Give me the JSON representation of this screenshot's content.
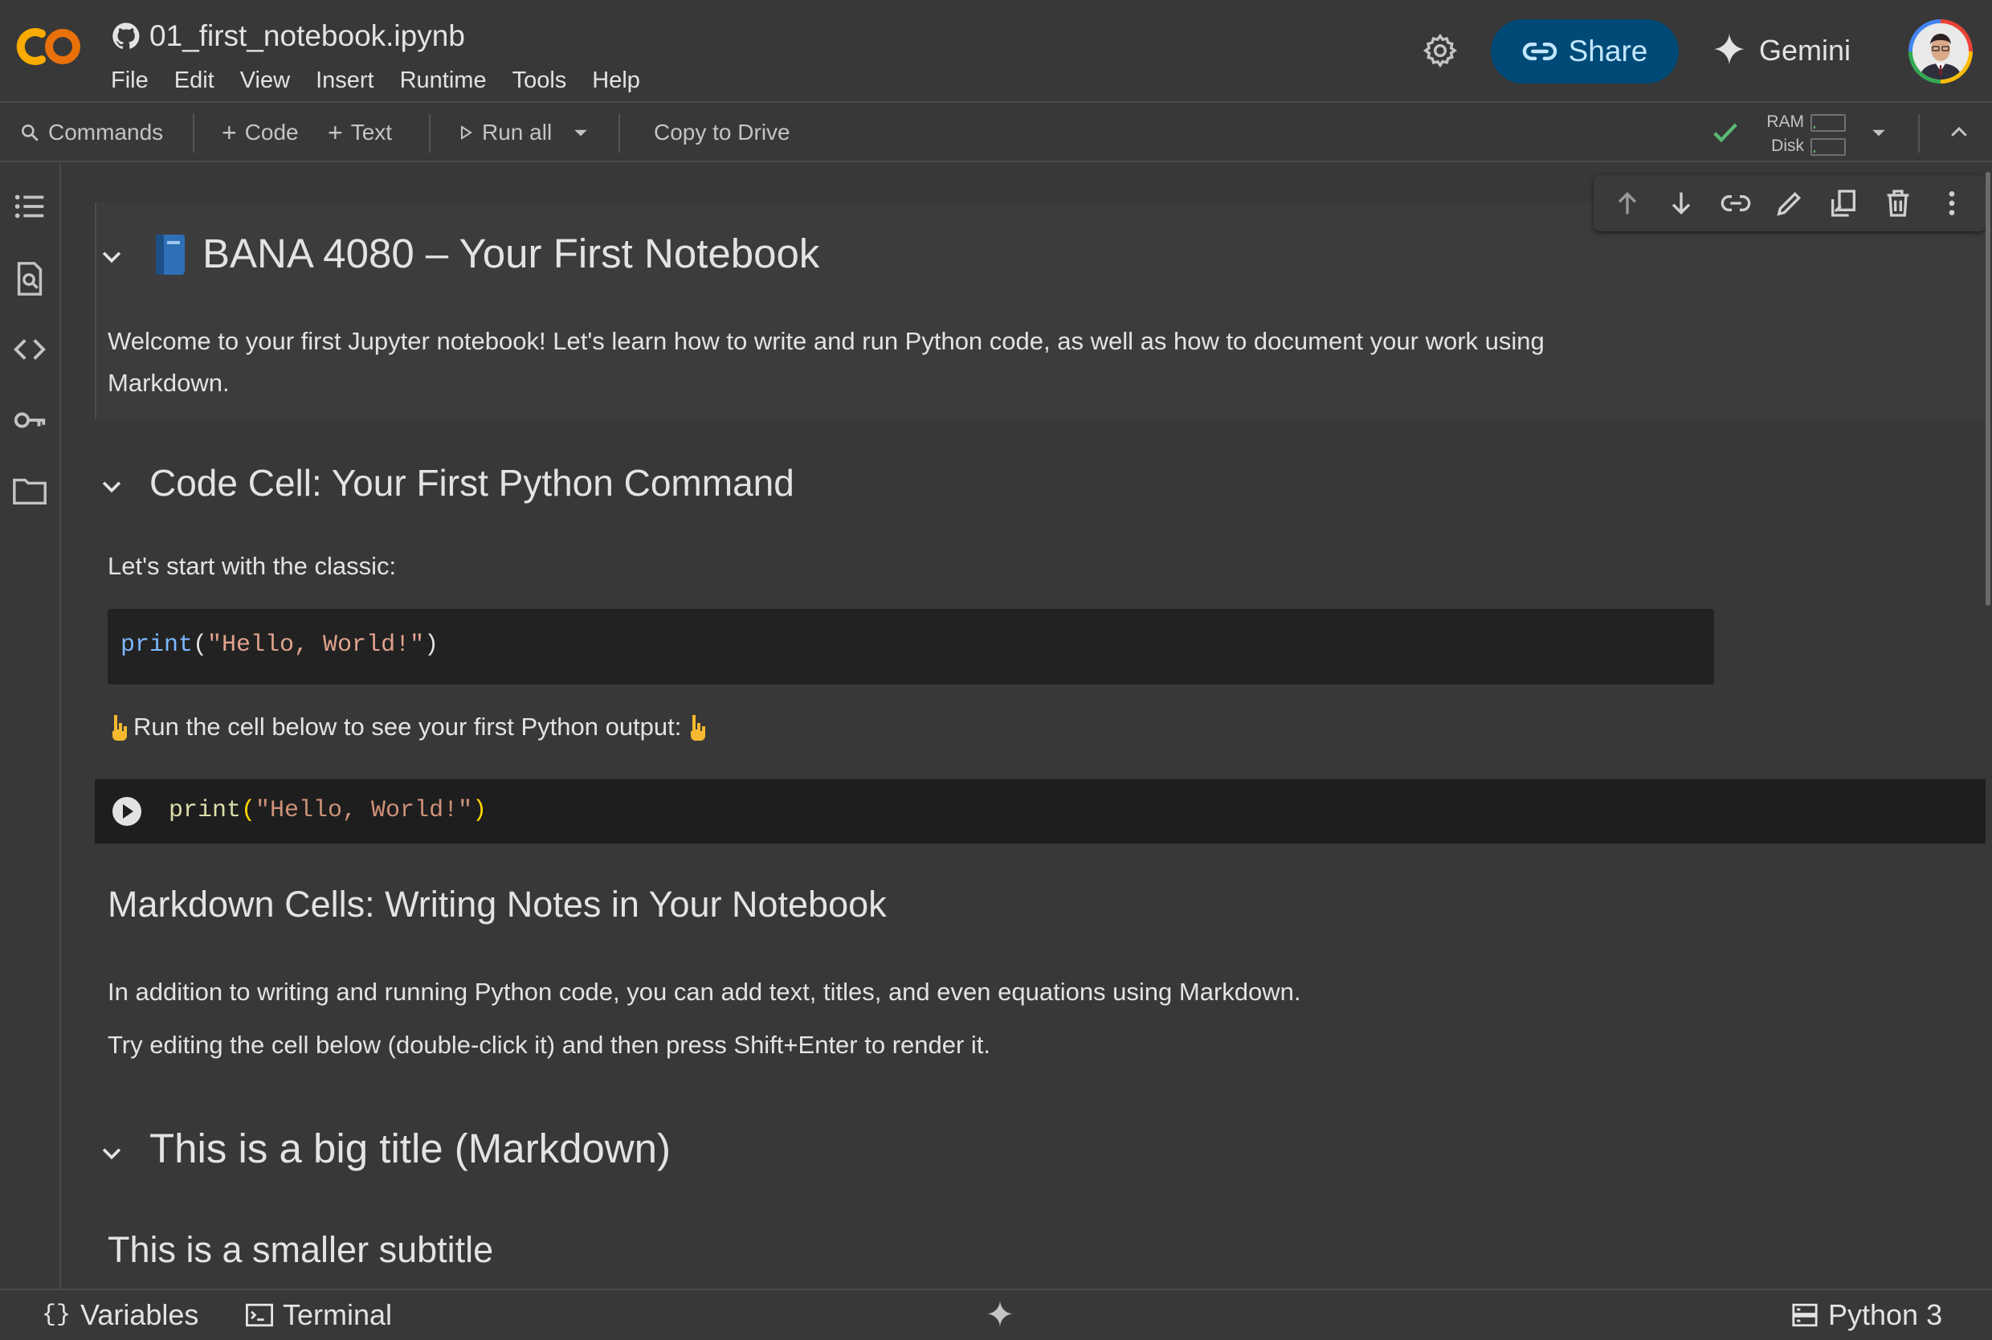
{
  "header": {
    "doc_title": "01_first_notebook.ipynb",
    "menu": [
      "File",
      "Edit",
      "View",
      "Insert",
      "Runtime",
      "Tools",
      "Help"
    ],
    "share_label": "Share",
    "gemini_label": "Gemini"
  },
  "toolbar": {
    "commands_label": "Commands",
    "code_label": "Code",
    "text_label": "Text",
    "run_all_label": "Run all",
    "copy_to_drive_label": "Copy to Drive",
    "ram_label": "RAM",
    "disk_label": "Disk"
  },
  "notebook": {
    "title": "BANA 4080 – Your First Notebook",
    "intro_line1": "Welcome to your first Jupyter notebook! Let's learn how to write and run Python code, as well as how to document your work using",
    "intro_line2": "Markdown.",
    "section1_heading": "Code Cell: Your First Python Command",
    "section1_text": "Let's start with the classic:",
    "md_code": {
      "fn": "print",
      "open": "(",
      "str": "\"Hello, World!\"",
      "close": ")"
    },
    "run_hint": "Run the cell below to see your first Python output:",
    "code_cell": {
      "fn": "print",
      "open": "(",
      "str": "\"Hello, World!\"",
      "close": ")"
    },
    "section2_heading": "Markdown Cells: Writing Notes in Your Notebook",
    "section2_line1": "In addition to writing and running Python code, you can add text, titles, and even equations using Markdown.",
    "section2_line2": "Try editing the cell below (double-click it) and then press Shift+Enter to render it.",
    "big_title": "This is a big title (Markdown)",
    "subtitle": "This is a smaller subtitle"
  },
  "statusbar": {
    "variables_label": "Variables",
    "terminal_label": "Terminal",
    "runtime_label": "Python 3"
  },
  "colors": {
    "background": "#383838",
    "share_bg": "#004a77",
    "share_text": "#c2e7ff",
    "logo_orange": "#f9ab00",
    "connected_green": "#5bb974"
  },
  "icons": {
    "logo": "colab-logo",
    "title": "github-icon",
    "settings": "gear-icon",
    "share": "link-icon",
    "gemini": "sparkle-icon",
    "commands": "search-icon",
    "run_all": "play-icon",
    "connected": "check-icon",
    "rail": [
      "toc-icon",
      "find-icon",
      "code-snippets-icon",
      "key-icon",
      "folder-icon"
    ],
    "cell_toolbar": [
      "arrow-up-icon",
      "arrow-down-icon",
      "link-icon",
      "pencil-icon",
      "mirror-cell-icon",
      "trash-icon",
      "more-vert-icon"
    ],
    "title_emoji": "blue-book-icon",
    "run_hint_emoji": "pointing-down-icon"
  },
  "resources": {
    "ram_used": 0.05,
    "disk_used": 0.05
  }
}
